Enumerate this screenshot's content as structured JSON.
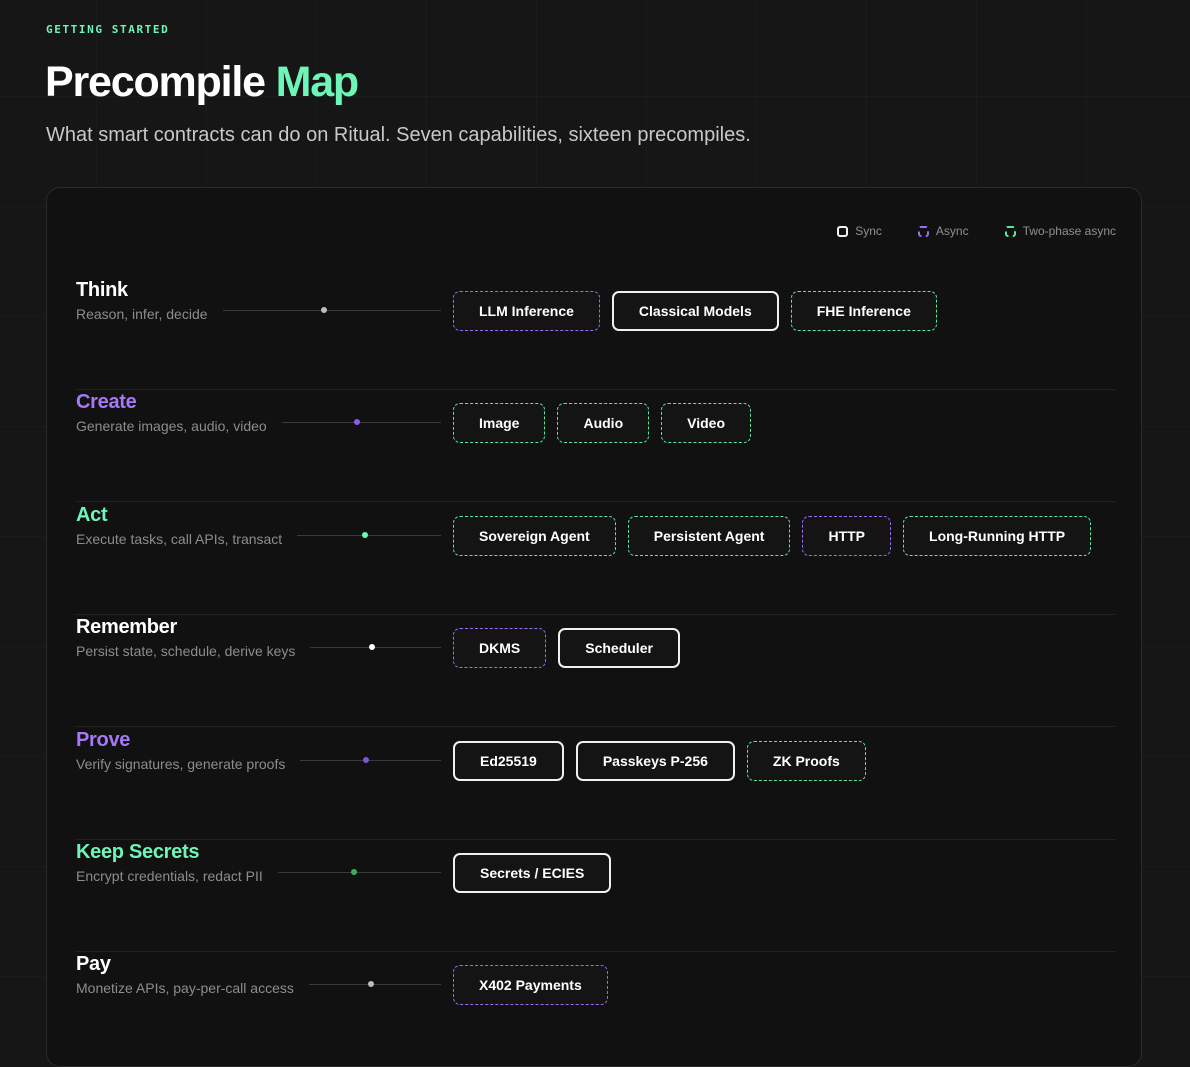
{
  "header": {
    "eyebrow": "GETTING STARTED",
    "title_main": "Precompile",
    "title_accent": "Map",
    "subtitle": "What smart contracts can do on Ritual. Seven capabilities, sixteen precompiles."
  },
  "legend": {
    "sync": "Sync",
    "async": "Async",
    "two_phase": "Two-phase async"
  },
  "colors": {
    "accent_green": "#6ef5b8",
    "accent_purple": "#a678f5",
    "sync_border": "#f0f0f0",
    "async_border": "#9a6cf2",
    "two_phase_border": "#5de69f"
  },
  "capabilities": [
    {
      "name": "Think",
      "description": "Reason, infer, decide",
      "name_color": "#ffffff",
      "dot_color": "#bdbdbd",
      "precompiles": [
        {
          "label": "LLM Inference",
          "mode": "async"
        },
        {
          "label": "Classical Models",
          "mode": "sync"
        },
        {
          "label": "FHE Inference",
          "mode": "twophase"
        }
      ]
    },
    {
      "name": "Create",
      "description": "Generate images, audio, video",
      "name_color": "#a678f5",
      "dot_color": "#8a5de8",
      "precompiles": [
        {
          "label": "Image",
          "mode": "twophase"
        },
        {
          "label": "Audio",
          "mode": "twophase"
        },
        {
          "label": "Video",
          "mode": "twophase"
        }
      ]
    },
    {
      "name": "Act",
      "description": "Execute tasks, call APIs, transact",
      "name_color": "#6ef5b8",
      "dot_color": "#6ef5b8",
      "precompiles": [
        {
          "label": "Sovereign Agent",
          "mode": "twophase"
        },
        {
          "label": "Persistent Agent",
          "mode": "twophase"
        },
        {
          "label": "HTTP",
          "mode": "async"
        },
        {
          "label": "Long-Running HTTP",
          "mode": "twophase"
        }
      ]
    },
    {
      "name": "Remember",
      "description": "Persist state, schedule, derive keys",
      "name_color": "#ffffff",
      "dot_color": "#ffffff",
      "precompiles": [
        {
          "label": "DKMS",
          "mode": "async"
        },
        {
          "label": "Scheduler",
          "mode": "sync"
        }
      ]
    },
    {
      "name": "Prove",
      "description": "Verify signatures, generate proofs",
      "name_color": "#a678f5",
      "dot_color": "#7d55d8",
      "precompiles": [
        {
          "label": "Ed25519",
          "mode": "sync"
        },
        {
          "label": "Passkeys P-256",
          "mode": "sync"
        },
        {
          "label": "ZK Proofs",
          "mode": "twophase"
        }
      ]
    },
    {
      "name": "Keep Secrets",
      "description": "Encrypt credentials, redact PII",
      "name_color": "#6ef5b8",
      "dot_color": "#3fae5c",
      "precompiles": [
        {
          "label": "Secrets / ECIES",
          "mode": "sync"
        }
      ]
    },
    {
      "name": "Pay",
      "description": "Monetize APIs, pay-per-call access",
      "name_color": "#ffffff",
      "dot_color": "#bdbdbd",
      "precompiles": [
        {
          "label": "X402 Payments",
          "mode": "async"
        }
      ]
    }
  ]
}
